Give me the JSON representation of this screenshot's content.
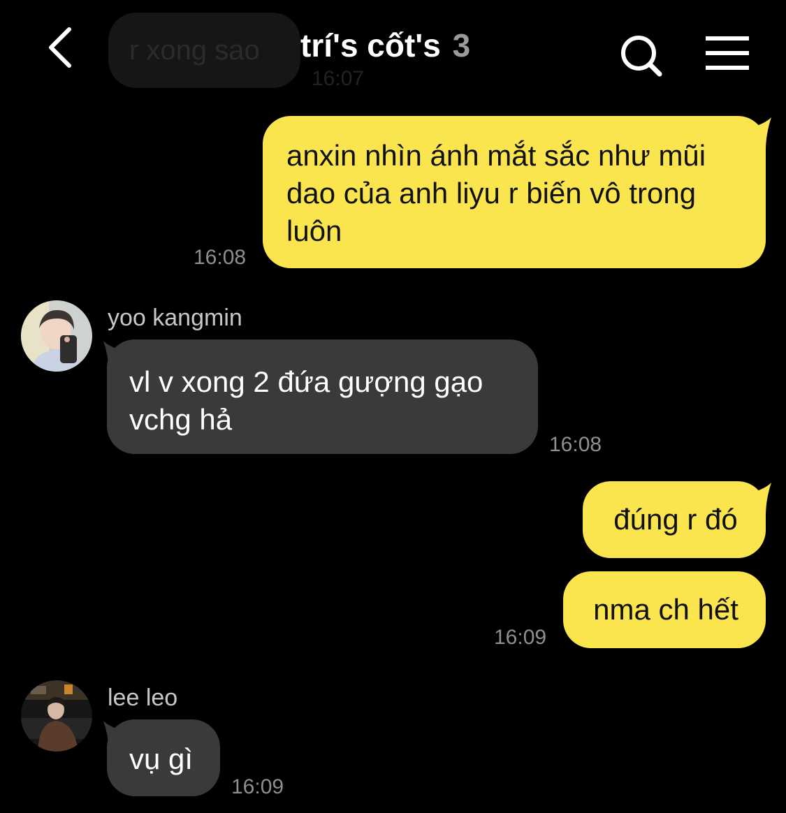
{
  "header": {
    "title": "trí's cốt's",
    "member_count": "3",
    "back_icon": "chevron-left-icon",
    "search_icon": "search-icon",
    "menu_icon": "hamburger-menu-icon"
  },
  "previous": {
    "text": "r xong sao",
    "time": "16:07"
  },
  "messages": [
    {
      "from": "me",
      "text": "anxin nhìn ánh mắt sắc như mũi dao của anh liyu r biến vô trong luôn",
      "time": "16:08"
    },
    {
      "from": "yoo kangmin",
      "text": "vl v xong 2 đứa gượng gạo vchg hả",
      "time": "16:08"
    },
    {
      "from": "me",
      "text": "đúng r đó"
    },
    {
      "from": "me",
      "text": "nma ch hết",
      "time": "16:09"
    },
    {
      "from": "lee leo",
      "text": "vụ gì",
      "time": "16:09"
    }
  ],
  "colors": {
    "my_bubble": "#fae54f",
    "their_bubble": "#3a3a3c",
    "background": "#000000",
    "timestamp": "#8e8e93"
  }
}
